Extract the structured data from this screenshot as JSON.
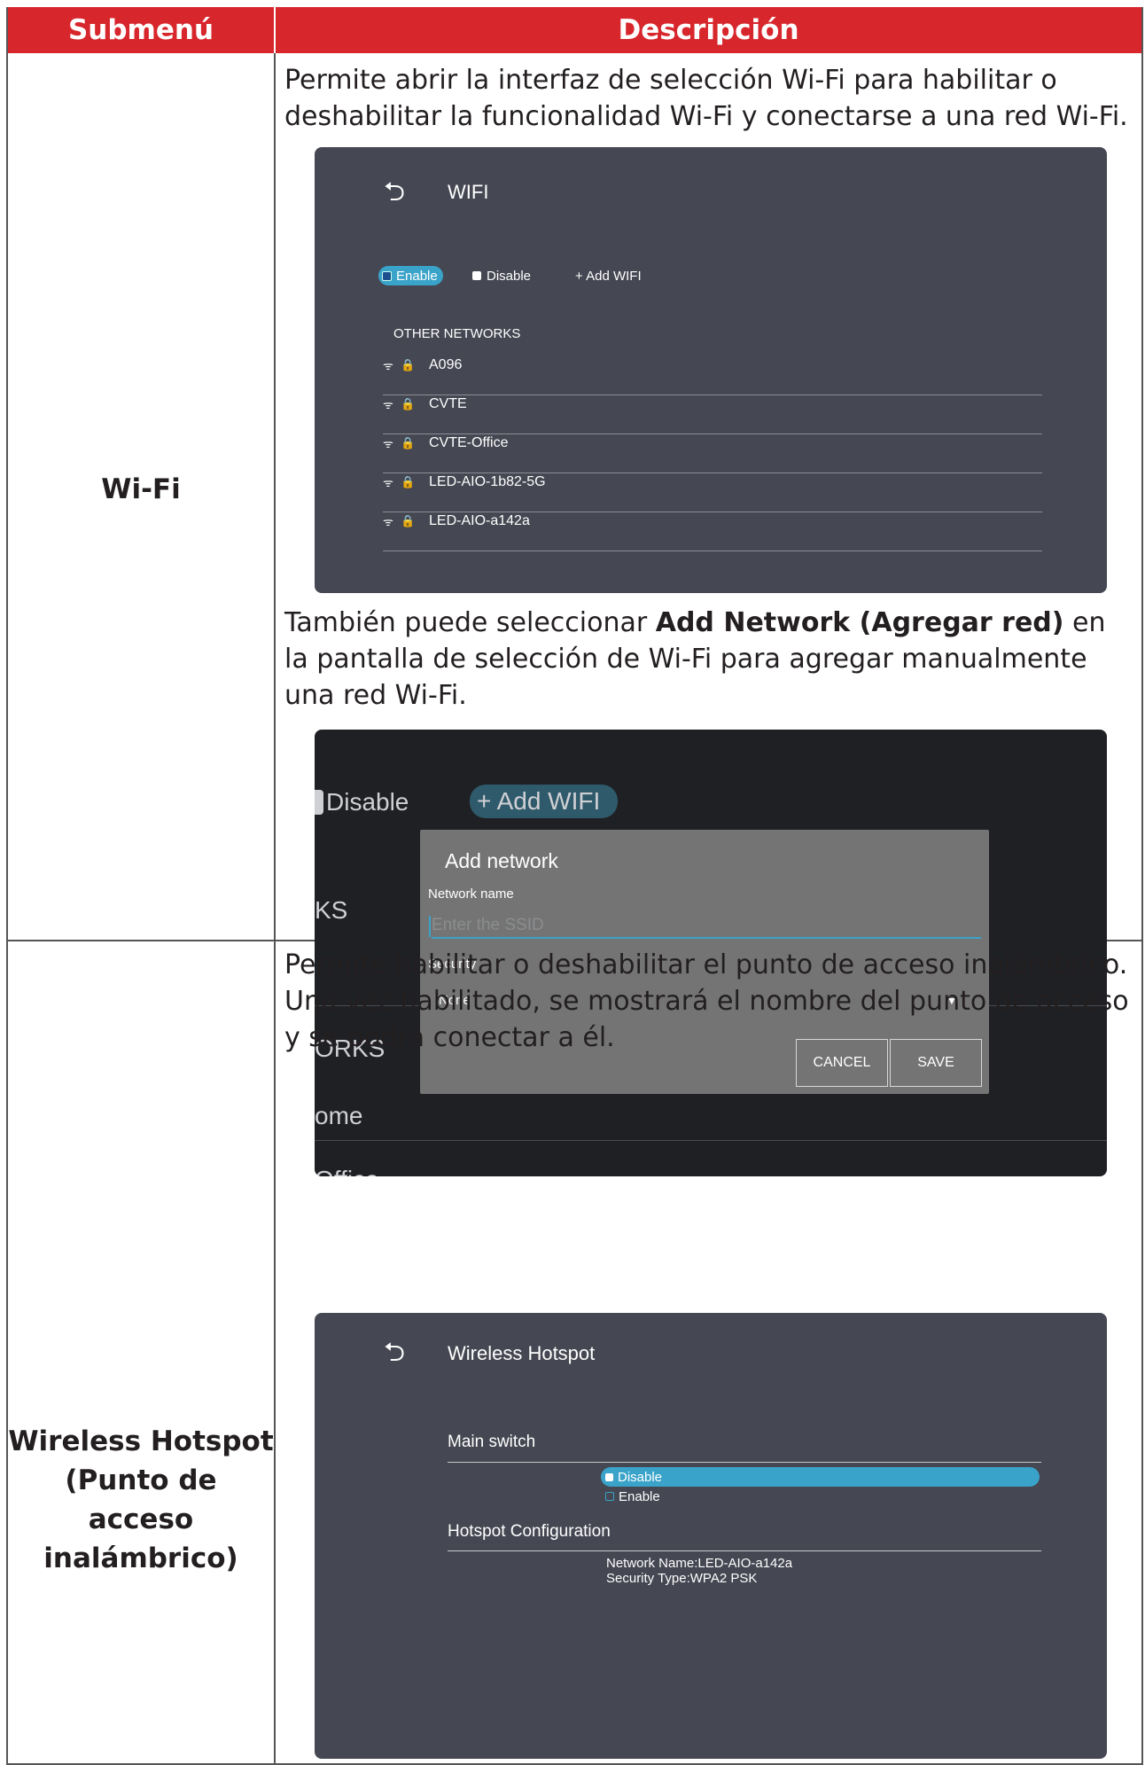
{
  "header": {
    "col1": "Submenú",
    "col2": "Descripción"
  },
  "rows": [
    {
      "submenu": "Wi-Fi",
      "desc1": "Permite abrir la interfaz de selección Wi-Fi para habilitar o deshabilitar la funcionalidad Wi-Fi y conectarse a una red Wi-Fi.",
      "desc2_pre": "También puede seleccionar ",
      "desc2_bold": "Add Network (Agregar red)",
      "desc2_post": " en la pantalla de selección de Wi-Fi para agregar manualmente una red Wi-Fi."
    },
    {
      "submenu_l1": "Wireless Hotspot",
      "submenu_l2": "(Punto de acceso",
      "submenu_l3": "inalámbrico)",
      "desc": "Permite habilitar o deshabilitar el punto de acceso inalámbrico. Una vez habilitado, se mostrará el nombre del punto de acceso y se podrá conectar a él."
    }
  ],
  "wifi_screen": {
    "back_icon": "back-arrow-icon",
    "title": "WIFI",
    "enable": "Enable",
    "disable": "Disable",
    "add": "+ Add WIFI",
    "section": "OTHER NETWORKS",
    "networks": [
      "A096",
      "CVTE",
      "CVTE-Office",
      "LED-AIO-1b82-5G",
      "LED-AIO-a142a"
    ],
    "wifi_icon": "wifi-icon",
    "lock_icon": "lock-icon"
  },
  "add_screen": {
    "bg_disable": "Disable",
    "bg_add": "+ Add WIFI",
    "bg_ks": "KS",
    "bg_works": "ORKS",
    "bg_ome": "ome",
    "bg_office": "Office",
    "dialog_title": "Add network",
    "name_label": "Network name",
    "name_placeholder": "Enter the SSID",
    "security_label": "Security",
    "security_value": "None",
    "cancel": "CANCEL",
    "save": "SAVE"
  },
  "hotspot_screen": {
    "title": "Wireless Hotspot",
    "main_switch": "Main switch",
    "disable": "Disable",
    "enable": "Enable",
    "config": "Hotspot Configuration",
    "network_name": "Network Name:LED-AIO-a142a",
    "security_type": "Security Type:WPA2 PSK"
  },
  "colors": {
    "header_red": "#d7262c",
    "panel": "#454752",
    "accent": "#3aa3c9"
  }
}
